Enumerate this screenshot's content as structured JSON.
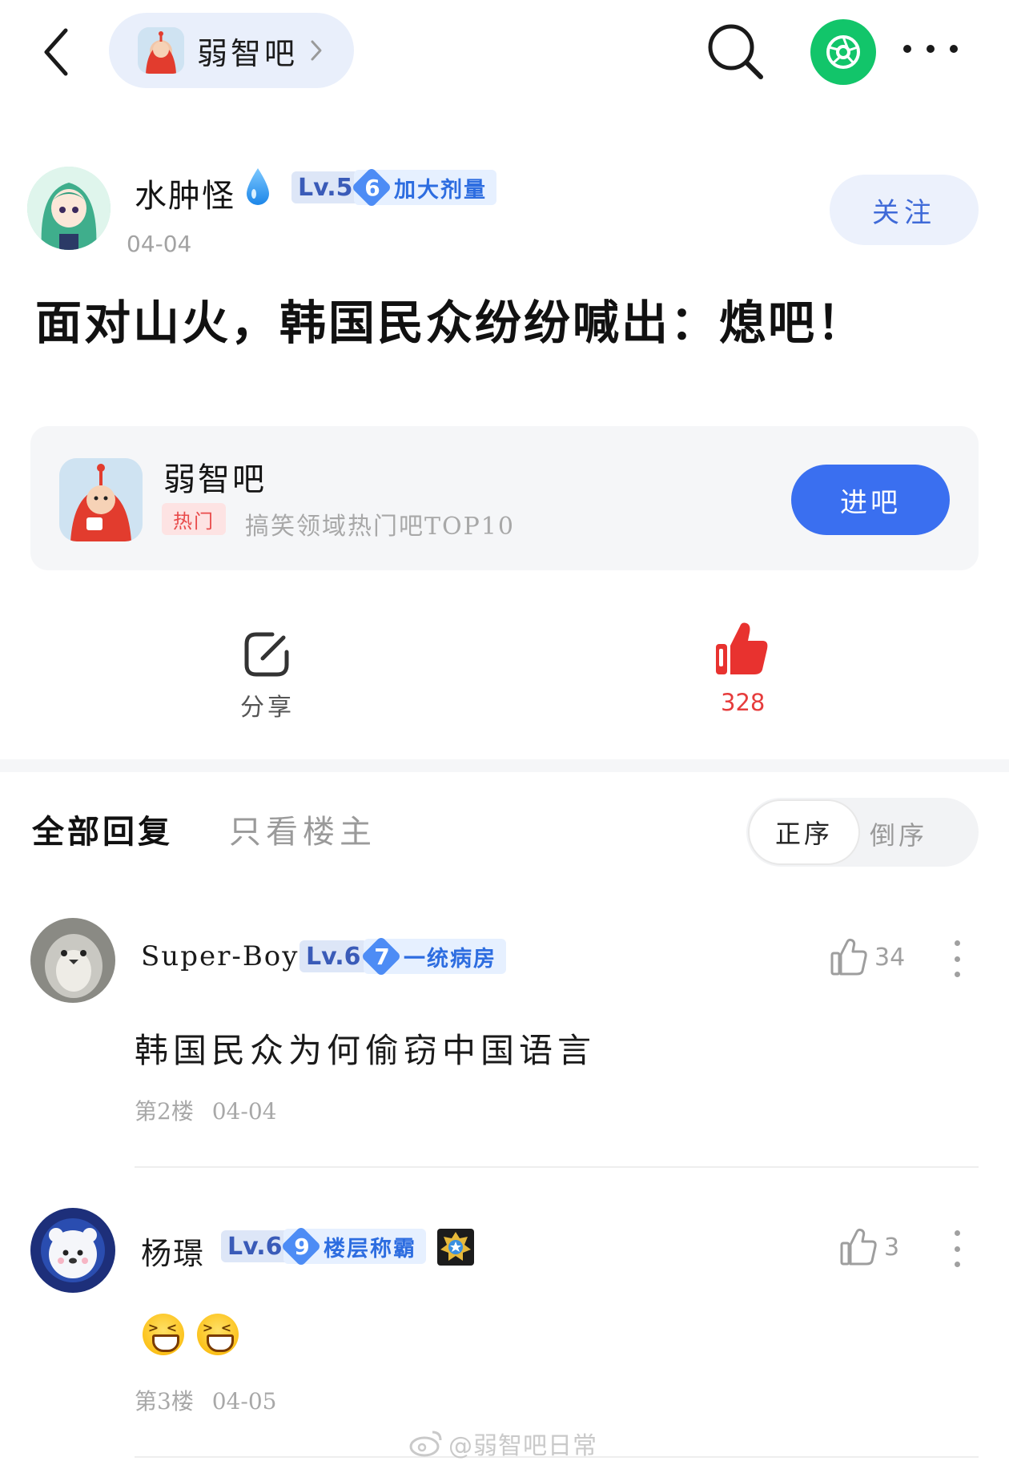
{
  "topbar": {
    "forum_name": "弱智吧",
    "colors": {
      "pill_bg": "#e9effb",
      "green": "#12c56a"
    }
  },
  "post": {
    "author": {
      "name": "水肿怪",
      "level": "Lv.5",
      "title_num": "6",
      "title": "加大剂量",
      "date": "04-04",
      "follow_label": "关注"
    },
    "title": "面对山火，韩国民众纷纷喊出：熄吧！",
    "forum_card": {
      "name": "弱智吧",
      "hot_tag": "热门",
      "desc": "搞笑领域热门吧TOP10",
      "enter_label": "进吧"
    },
    "actions": {
      "share_label": "分享",
      "like_count": "328",
      "like_color": "#e63c3c"
    }
  },
  "tabs": {
    "all": "全部回复",
    "op_only": "只看楼主",
    "sort_asc": "正序",
    "sort_desc": "倒序"
  },
  "replies": [
    {
      "name": "Super-Boy",
      "level": "Lv.6",
      "title_num": "7",
      "title": "一统病房",
      "likes": "34",
      "body": "韩国民众为何偷窃中国语言",
      "floor": "第2楼",
      "date": "04-04"
    },
    {
      "name": "杨璟",
      "level": "Lv.6",
      "title_num": "9",
      "title": "楼层称霸",
      "likes": "3",
      "body": "",
      "floor": "第3楼",
      "date": "04-05"
    }
  ],
  "watermark": "@弱智吧日常",
  "icons": [
    "back-icon",
    "chevron-right-icon",
    "search-icon",
    "shutter-icon",
    "more-icon",
    "water-drop-icon",
    "share-icon",
    "thumbs-up-icon",
    "weibo-icon",
    "laughing-emoji-icon",
    "medal-icon"
  ],
  "accent": "#3a6ff0"
}
